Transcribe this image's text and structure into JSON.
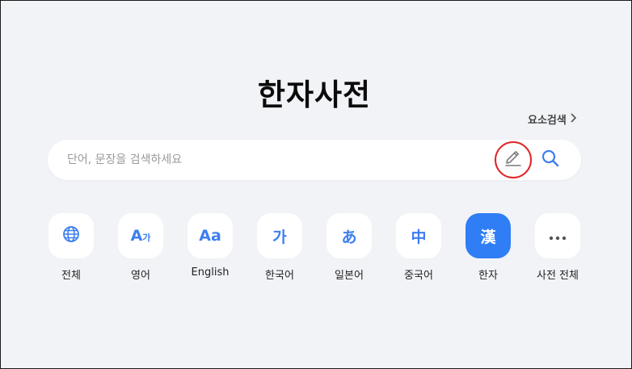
{
  "page": {
    "title": "한자사전"
  },
  "element_search": {
    "label": "요소검색"
  },
  "search": {
    "placeholder": "단어, 문장을 검색하세요",
    "value": ""
  },
  "categories": [
    {
      "id": "all",
      "icon": "globe-icon",
      "label": "전체"
    },
    {
      "id": "english-kor",
      "icon_main": "A",
      "icon_sub": "가",
      "label": "영어"
    },
    {
      "id": "english",
      "icon_text": "Aa",
      "label": "English"
    },
    {
      "id": "korean",
      "icon_text": "가",
      "label": "한국어"
    },
    {
      "id": "japanese",
      "icon_text": "あ",
      "label": "일본어"
    },
    {
      "id": "chinese",
      "icon_text": "中",
      "label": "중국어"
    },
    {
      "id": "hanja",
      "icon_text": "漢",
      "label": "한자",
      "active": true
    },
    {
      "id": "more",
      "icon": "more-dots-icon",
      "label": "사전 전체"
    }
  ],
  "colors": {
    "accent": "#2f7ef5",
    "icon": "#3d7ef0",
    "background": "#f2f3f7",
    "highlight_ring": "#e02424"
  }
}
